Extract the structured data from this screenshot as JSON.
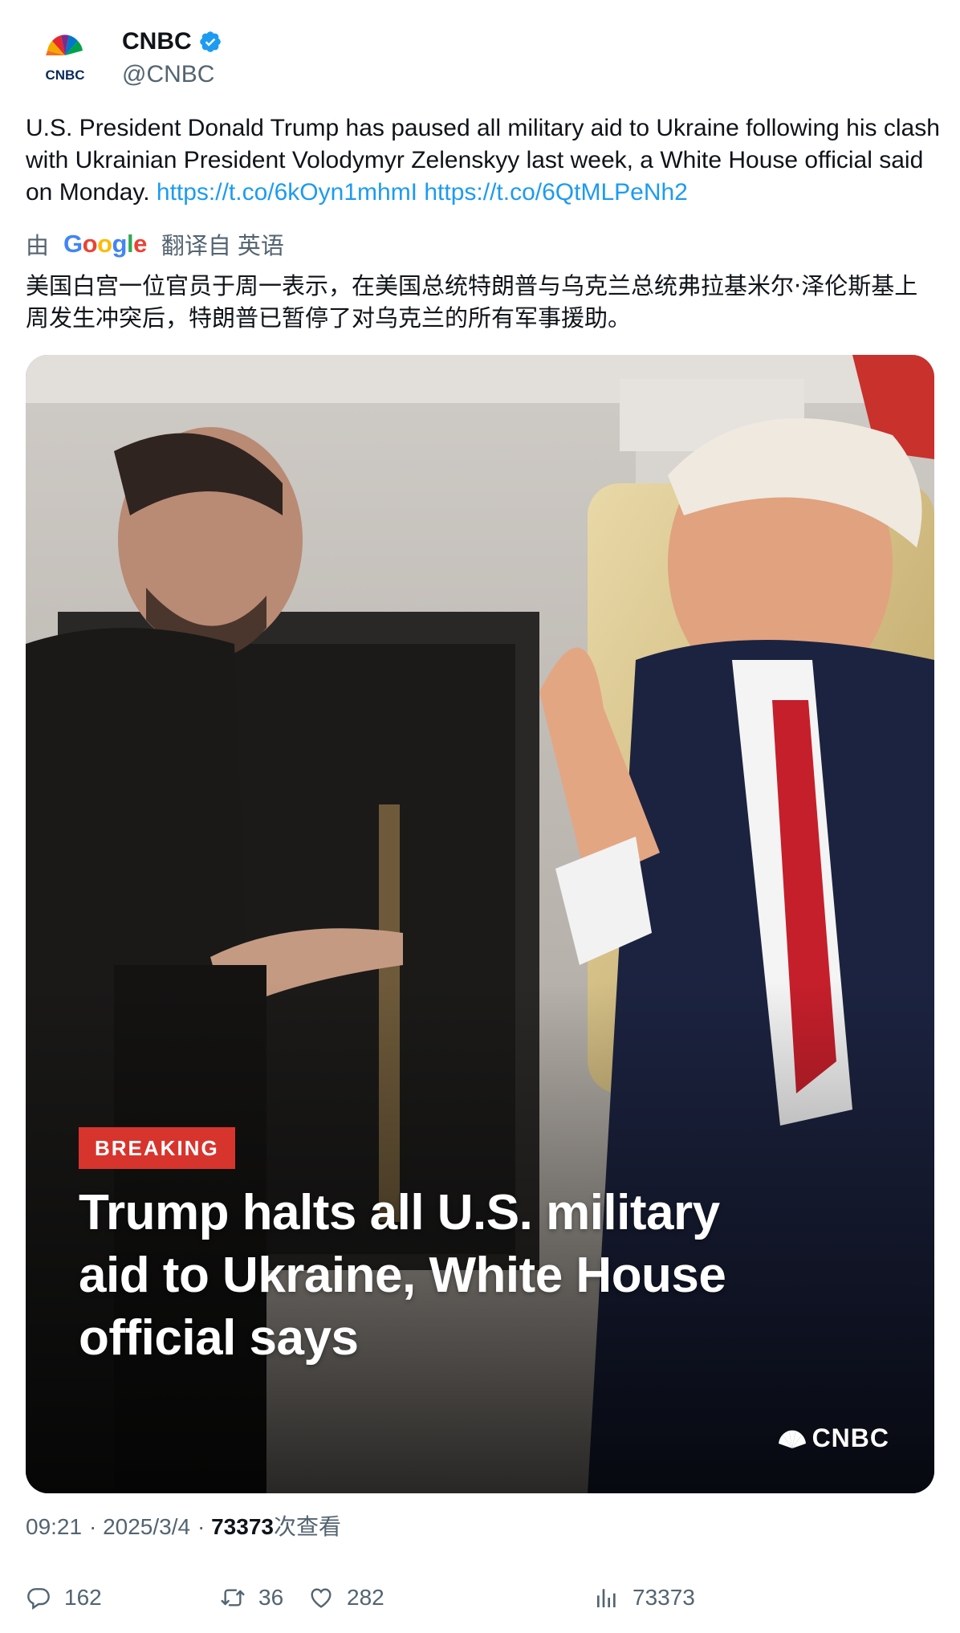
{
  "account": {
    "display_name": "CNBC",
    "handle": "@CNBC",
    "verified": true,
    "avatar_text": "CNBC"
  },
  "tweet": {
    "text_main": "U.S. President Donald Trump has paused all military aid to Ukraine following his clash with Ukrainian President Volodymyr Zelenskyy last week, a White House official said on Monday. ",
    "link1": "https://t.co/6kOyn1mhmI",
    "link2": "https://t.co/6QtMLPeNh2"
  },
  "translation": {
    "prefix": "由",
    "provider": "Google",
    "suffix": "翻译自 英语",
    "text": "美国白宫一位官员于周一表示，在美国总统特朗普与乌克兰总统弗拉基米尔·泽伦斯基上周发生冲突后，特朗普已暂停了对乌克兰的所有军事援助。"
  },
  "media": {
    "badge": "BREAKING",
    "headline": "Trump halts all U.S. military aid to Ukraine, White House official says",
    "brand": "CNBC"
  },
  "meta": {
    "time": "09:21",
    "date": "2025/3/4",
    "views": "73373",
    "views_label": "次查看"
  },
  "actions": {
    "replies": "162",
    "retweets": "36",
    "likes": "282",
    "views": "73373"
  },
  "colors": {
    "link": "#1d9bf0",
    "secondary_text": "#536471",
    "verified": "#1d9bf0",
    "breaking_badge": "#d8342e"
  }
}
